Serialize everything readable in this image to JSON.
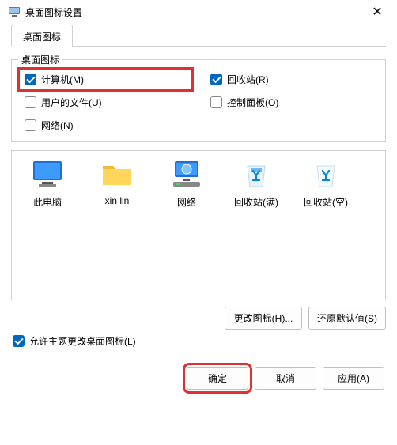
{
  "title": "桌面图标设置",
  "tab_label": "桌面图标",
  "group_label": "桌面图标",
  "checks": {
    "computer": "计算机(M)",
    "recycle": "回收站(R)",
    "userfiles": "用户的文件(U)",
    "control": "控制面板(O)",
    "network": "网络(N)"
  },
  "icons": {
    "thispc": "此电脑",
    "folder": "xin lin",
    "network": "网络",
    "recycle_full": "回收站(满)",
    "recycle_empty": "回收站(空)"
  },
  "buttons": {
    "change_icon": "更改图标(H)...",
    "restore_default": "还原默认值(S)",
    "ok": "确定",
    "cancel": "取消",
    "apply": "应用(A)"
  },
  "theme_allow": "允许主题更改桌面图标(L)"
}
